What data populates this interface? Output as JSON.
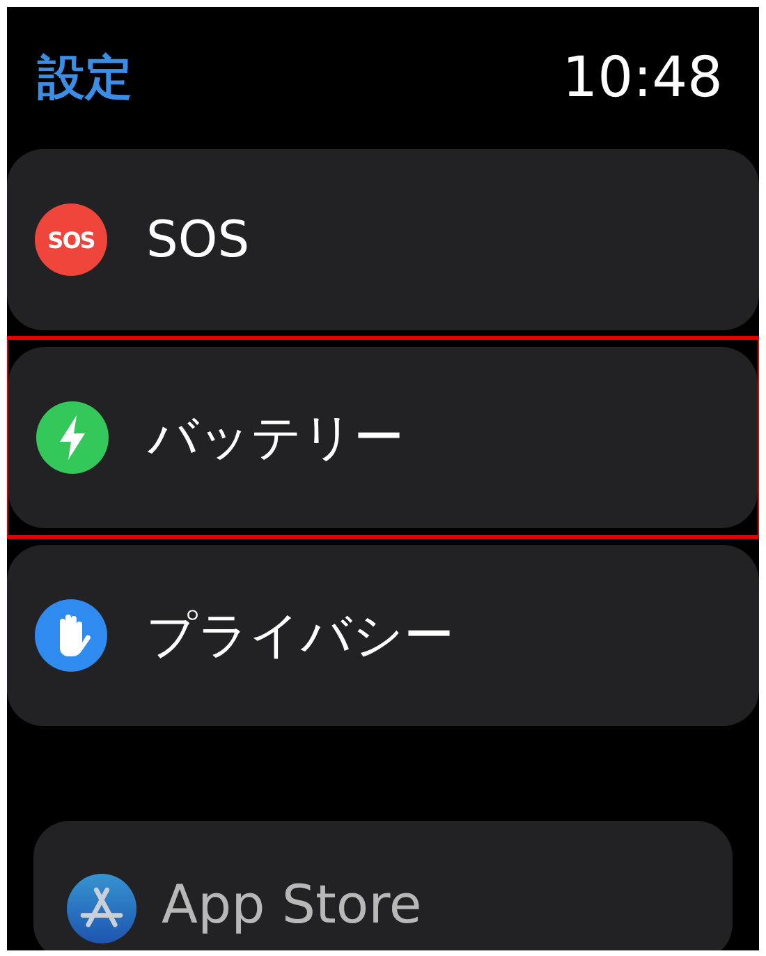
{
  "header": {
    "title": "設定",
    "time": "10:48"
  },
  "items": [
    {
      "kind": "sos",
      "icon_label": "SOS",
      "label": "SOS",
      "highlighted": false,
      "dimmed": false
    },
    {
      "kind": "battery",
      "label": "バッテリー",
      "highlighted": true,
      "dimmed": false
    },
    {
      "kind": "privacy",
      "label": "プライバシー",
      "highlighted": false,
      "dimmed": false
    },
    {
      "kind": "appstore",
      "label": "App Store",
      "highlighted": false,
      "dimmed": true
    }
  ]
}
